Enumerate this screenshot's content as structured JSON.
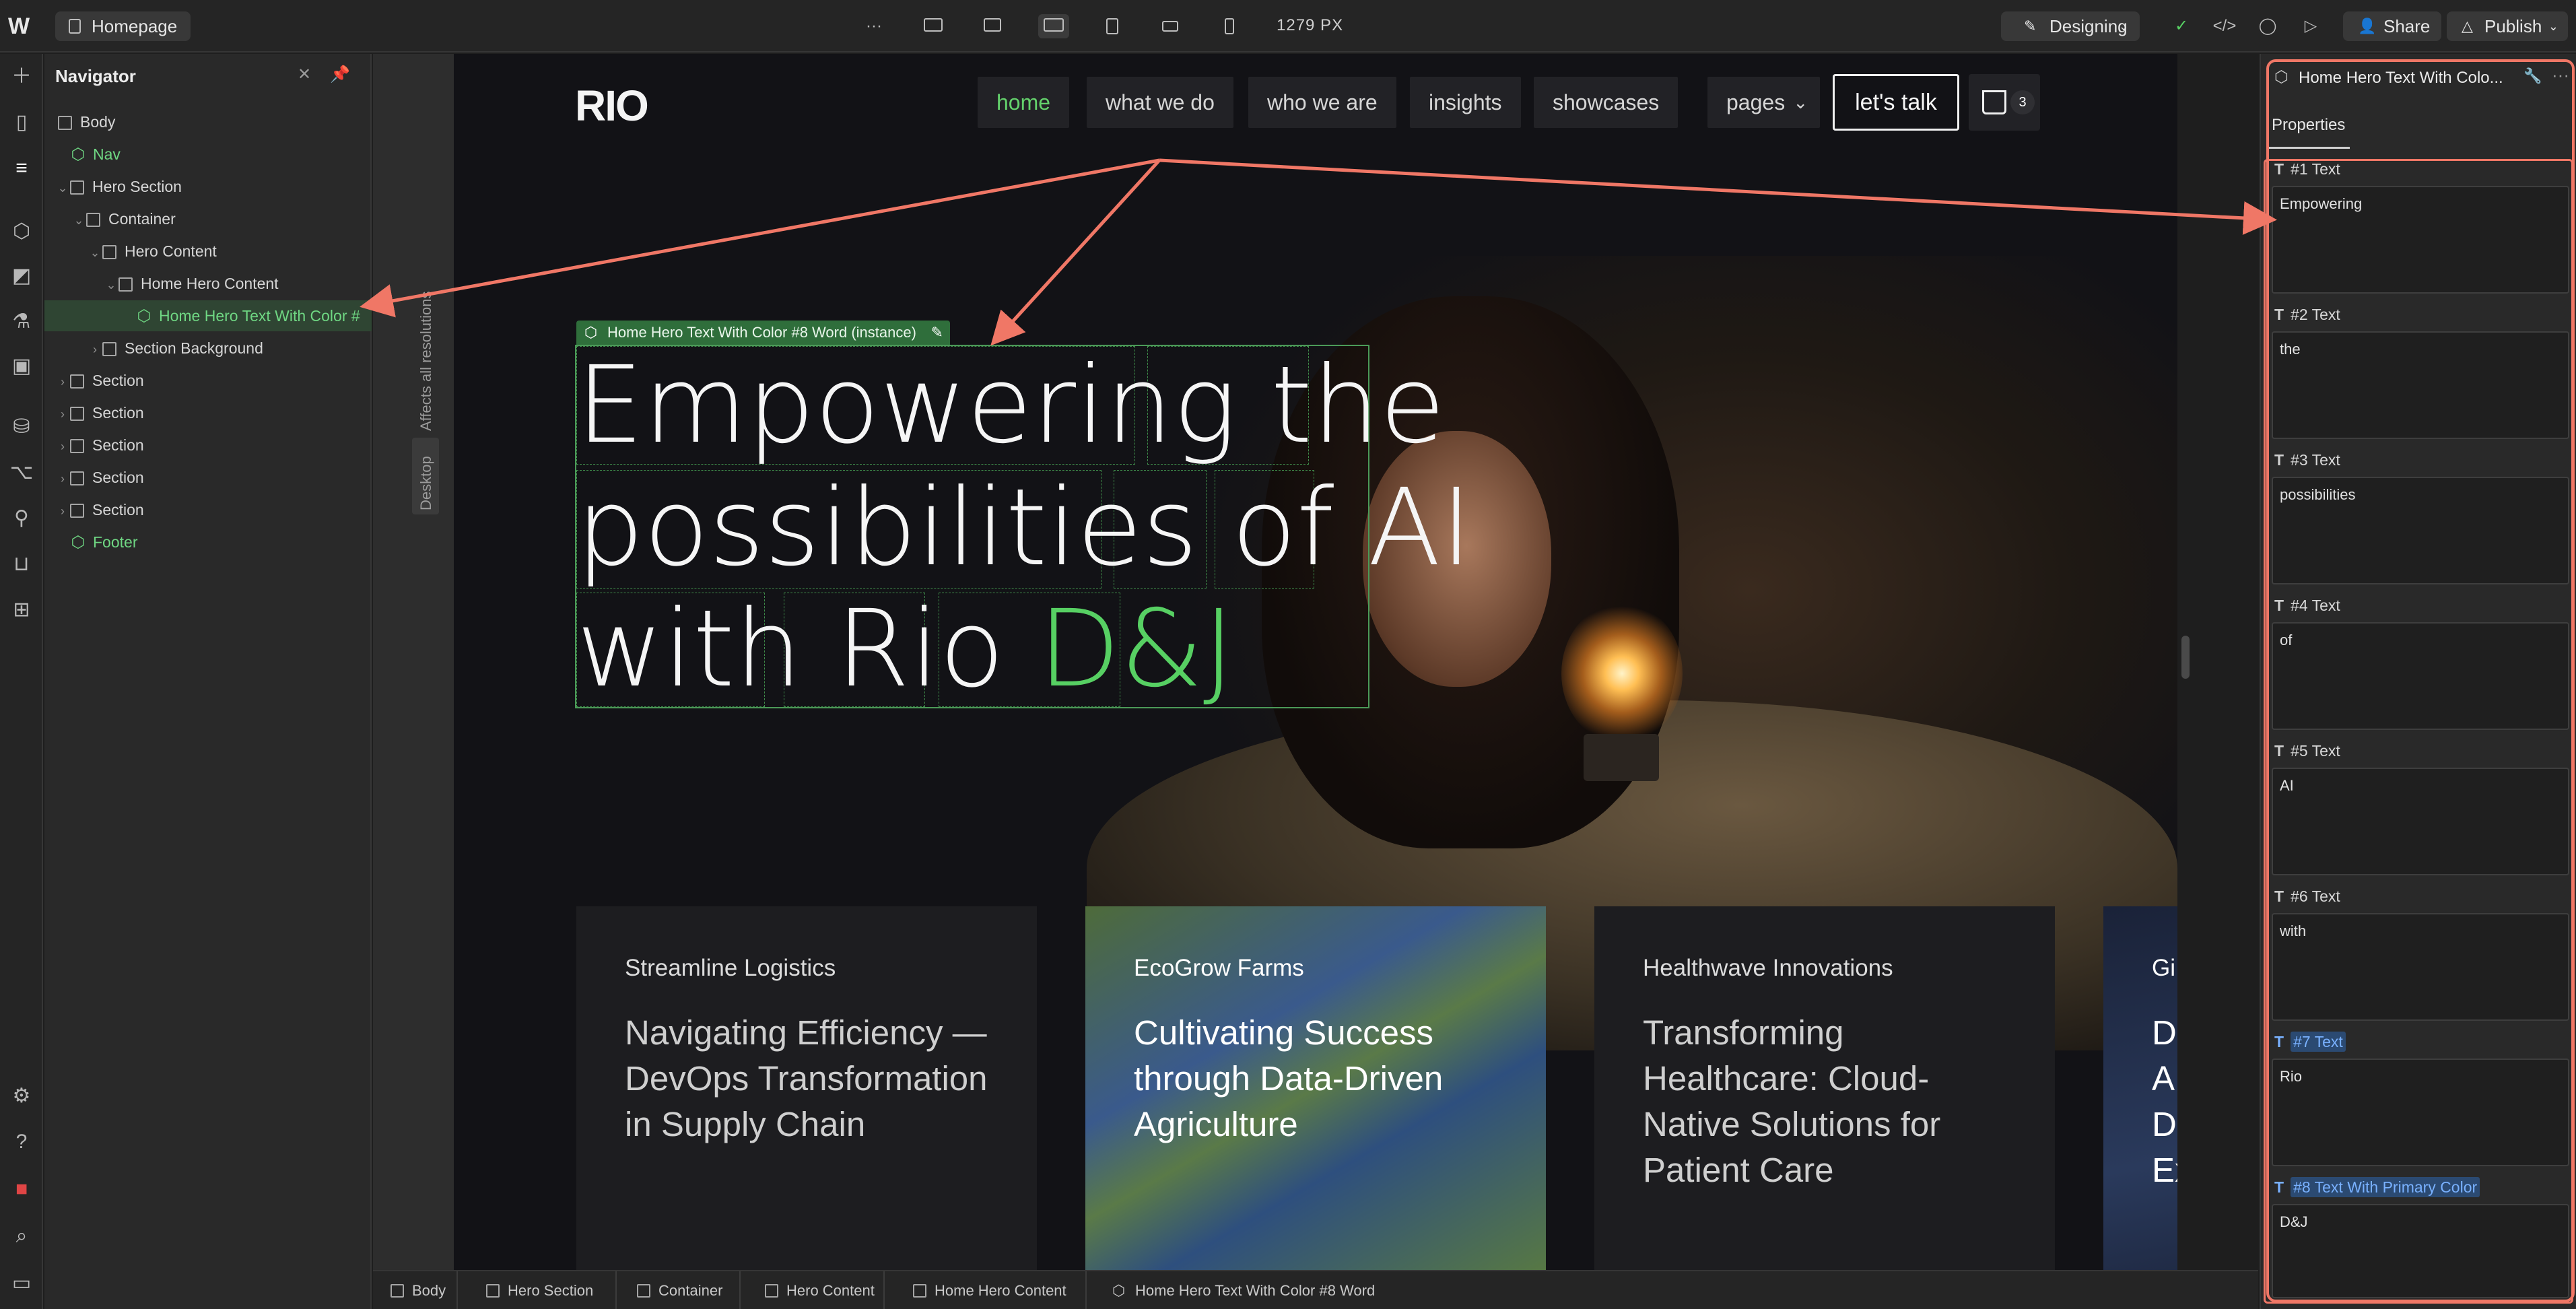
{
  "topbar": {
    "logo": "W",
    "page_name": "Homepage",
    "more": "···",
    "width_readout": "1279 PX",
    "mode": "Designing",
    "share": "Share",
    "publish": "Publish"
  },
  "navigator": {
    "title": "Navigator",
    "items": [
      {
        "label": "Body"
      },
      {
        "label": "Nav"
      },
      {
        "label": "Hero Section"
      },
      {
        "label": "Container"
      },
      {
        "label": "Hero Content"
      },
      {
        "label": "Home Hero Content"
      },
      {
        "label": "Home Hero Text With Color #"
      },
      {
        "label": "Section Background"
      },
      {
        "label": "Section"
      },
      {
        "label": "Section"
      },
      {
        "label": "Section"
      },
      {
        "label": "Section"
      },
      {
        "label": "Section"
      },
      {
        "label": "Footer"
      }
    ]
  },
  "gutter": {
    "affects": "Affects all resolutions",
    "breakpoint": "Desktop"
  },
  "site": {
    "logo": "RIO",
    "nav": [
      "home",
      "what we do",
      "who we are",
      "insights",
      "showcases",
      "pages"
    ],
    "cta": "let's talk",
    "cart_count": "3",
    "element_tag": "Home Hero Text With Color #8 Word (instance)",
    "hero": {
      "line1_a": "Empowering",
      "line1_b": "the",
      "line2_a": "possibilities",
      "line2_b": "of",
      "line2_c": "AI",
      "line3_a": "with",
      "line3_b": "Rio",
      "line3_c": "D&J"
    },
    "cards": [
      {
        "tag": "Streamline Logistics",
        "title": "Navigating Efficiency — DevOps Transformation in Supply Chain"
      },
      {
        "tag": "EcoGrow Farms",
        "title": "Cultivating Success through Data-Driven Agriculture"
      },
      {
        "tag": "Healthwave Innovations",
        "title": "Transforming Healthcare: Cloud-Native Solutions for Patient Care"
      },
      {
        "tag": "Gi",
        "title": "D A D Ex"
      }
    ]
  },
  "breadcrumbs": [
    "Body",
    "Hero Section",
    "Container",
    "Hero Content",
    "Home Hero Content",
    "Home Hero Text With Color #8 Word"
  ],
  "panel": {
    "title": "Home Hero Text With Colo...",
    "tab": "Properties",
    "fields": [
      {
        "label": "#1 Text",
        "value": "Empowering"
      },
      {
        "label": "#2 Text",
        "value": "the"
      },
      {
        "label": "#3 Text",
        "value": "possibilities"
      },
      {
        "label": "#4 Text",
        "value": "of"
      },
      {
        "label": "#5 Text",
        "value": "AI"
      },
      {
        "label": "#6 Text",
        "value": "with"
      },
      {
        "label": "#7 Text",
        "value": "Rio"
      },
      {
        "label": "#8 Text With Primary Color",
        "value": "D&J"
      }
    ]
  },
  "colors": {
    "accent_green": "#57d063",
    "annotation_red": "#f07766",
    "highlight_blue": "#79b1ff"
  }
}
